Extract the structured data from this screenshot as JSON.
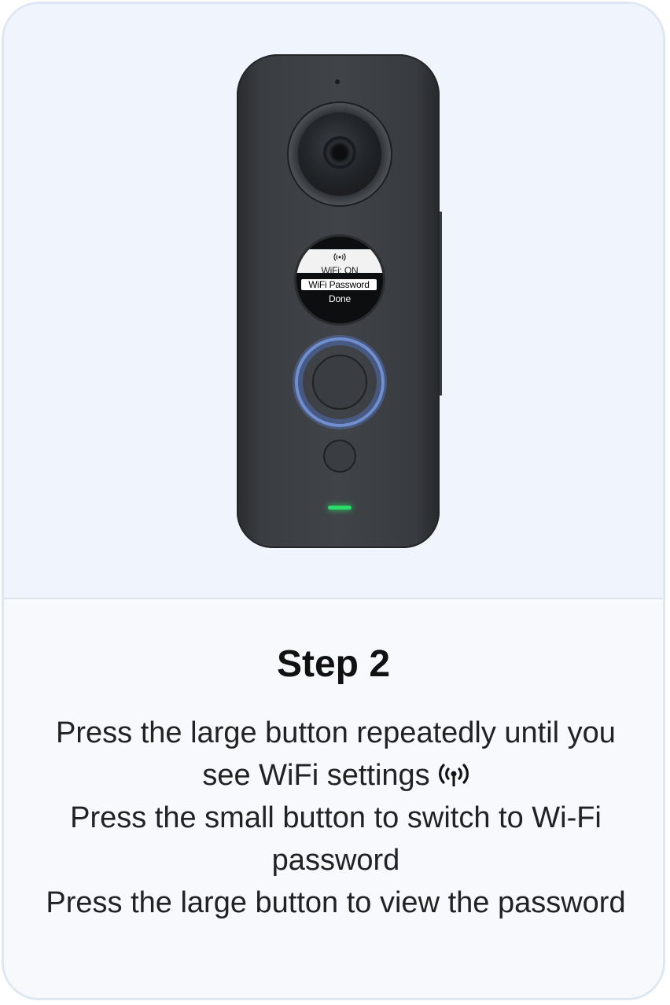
{
  "device": {
    "screen_lines": [
      "WiFi: ON",
      "WiFi Password",
      "Done"
    ]
  },
  "step": {
    "title": "Step 2",
    "instructions": [
      "Press the large button repeatedly until you see WiFi settings",
      "Press the small button to switch to Wi-Fi password",
      "Press the large button to view the password"
    ]
  },
  "icons": {
    "wifi_icon": "wifi-broadcast-icon"
  },
  "colors": {
    "led": "#2bdc6a",
    "button_ring": "#6f8fd0",
    "card_border": "#dfe7f3"
  }
}
